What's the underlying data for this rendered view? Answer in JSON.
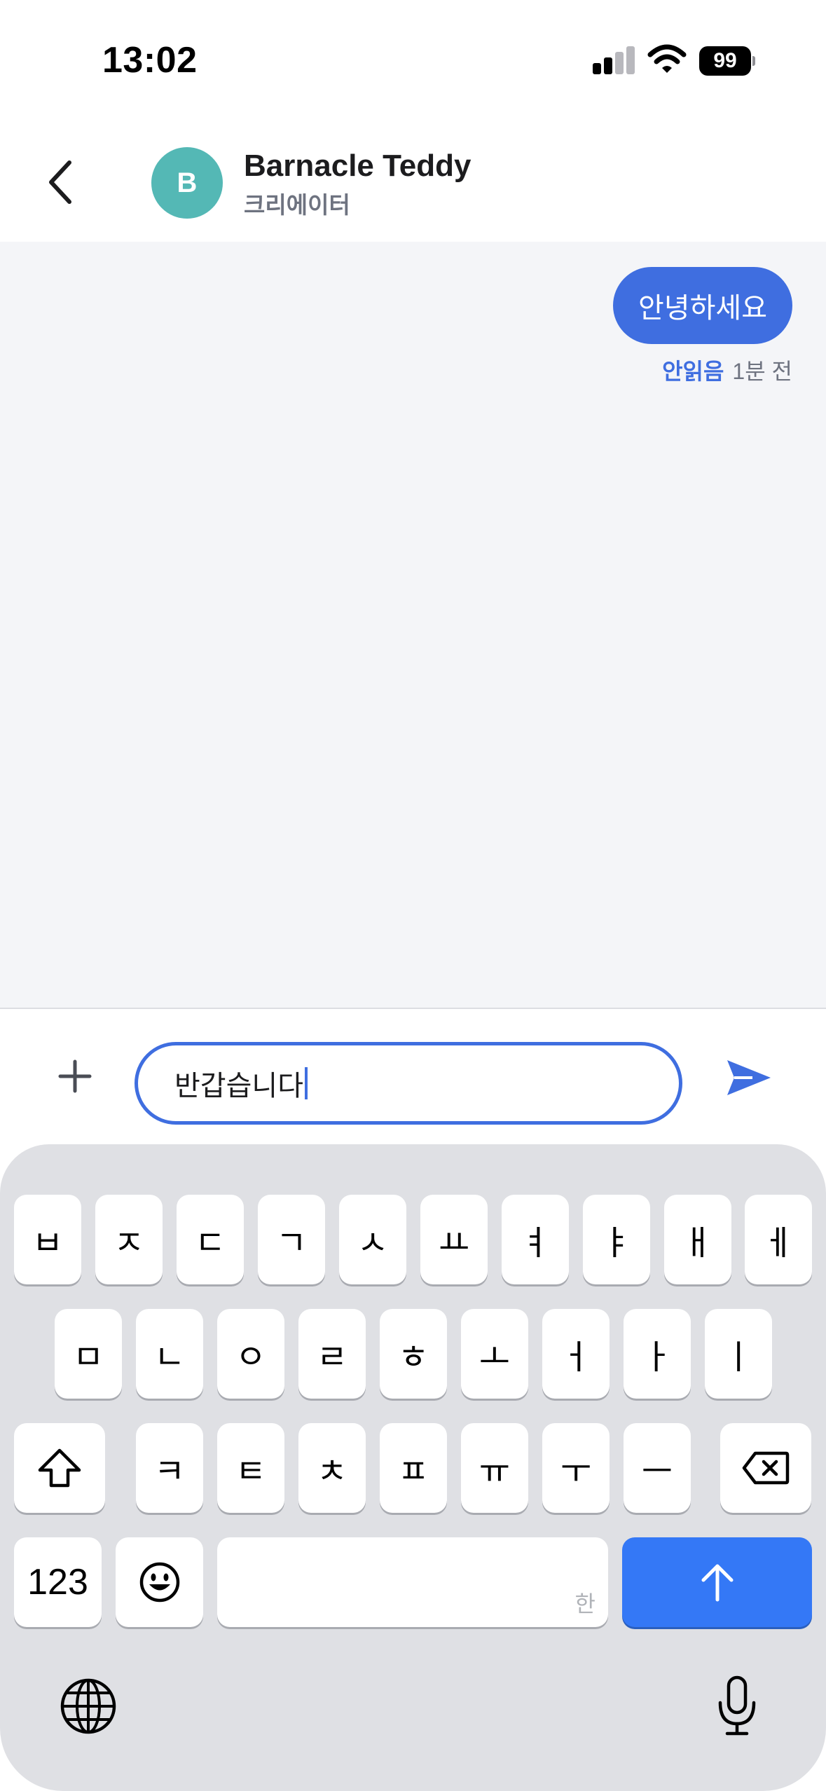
{
  "status_bar": {
    "time": "13:02",
    "battery": "99"
  },
  "header": {
    "avatar_initial": "B",
    "name": "Barnacle Teddy",
    "role": "크리에이터"
  },
  "messages": [
    {
      "text": "안녕하세요",
      "status": "안읽음",
      "time": "1분 전",
      "sender": "me"
    }
  ],
  "composer": {
    "input_value": "반갑습니다"
  },
  "keyboard": {
    "row1": [
      "ㅂ",
      "ㅈ",
      "ㄷ",
      "ㄱ",
      "ㅅ",
      "ㅛ",
      "ㅕ",
      "ㅑ",
      "ㅐ",
      "ㅔ"
    ],
    "row2": [
      "ㅁ",
      "ㄴ",
      "ㅇ",
      "ㄹ",
      "ㅎ",
      "ㅗ",
      "ㅓ",
      "ㅏ",
      "ㅣ"
    ],
    "row3": [
      "ㅋ",
      "ㅌ",
      "ㅊ",
      "ㅍ",
      "ㅠ",
      "ㅜ",
      "ㅡ"
    ],
    "numbers_label": "123",
    "space_hint": "한"
  },
  "icons": {
    "back": "chevron-left-icon",
    "plus": "plus-icon",
    "send": "send-icon",
    "shift": "shift-icon",
    "delete": "backspace-icon",
    "emoji": "emoji-icon",
    "return": "arrow-up-icon",
    "globe": "globe-icon",
    "mic": "microphone-icon"
  },
  "colors": {
    "accent": "#3f6ee0",
    "avatar": "#54b8b5",
    "return_key": "#3478f6"
  }
}
